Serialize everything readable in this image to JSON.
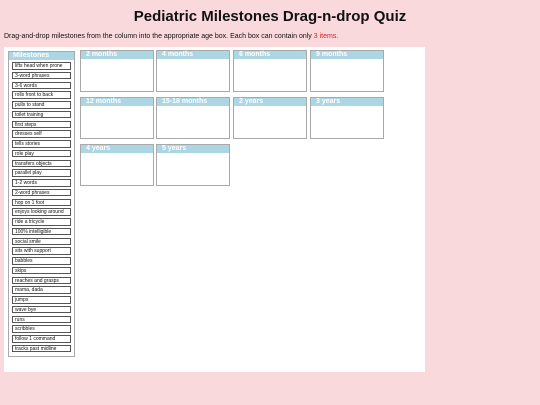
{
  "title": "Pediatric Milestones Drag-n-drop Quiz",
  "instructions": {
    "text": "Drag-and-drop milestones from the column into the appropriate age box. Each box can contain only ",
    "limit": "3 items."
  },
  "colors": {
    "background": "#fad9dd",
    "header_blue": "#acd6e3",
    "limit_red": "#d42020"
  },
  "milestones": {
    "header": "Milestones",
    "items": [
      "lifts head when prone",
      "3-word phrases",
      "3-6 words",
      "rolls front to back",
      "pulls to stand",
      "toilet training",
      "first steps",
      "dresses self",
      "tells stories",
      "role play",
      "transfers objects",
      "parallel play",
      "1-2 words",
      "2-word phrases",
      "hop on 1 foot",
      "enjoys looking around",
      "ride a tricycle",
      "100% intelligible",
      "social smile",
      "sits with support",
      "babbles",
      "skips",
      "reaches and grasps",
      "mama, dada",
      "jumps",
      "wave bye",
      "runs",
      "scribbles",
      "follow 1 command",
      "tracks past midline"
    ]
  },
  "age_boxes": [
    {
      "label": "2 months"
    },
    {
      "label": "4 months"
    },
    {
      "label": "6 months"
    },
    {
      "label": "9 months"
    },
    {
      "label": "12 months"
    },
    {
      "label": "15-18 months"
    },
    {
      "label": "2 years"
    },
    {
      "label": "3 years"
    },
    {
      "label": "4 years"
    },
    {
      "label": "5 years"
    }
  ]
}
